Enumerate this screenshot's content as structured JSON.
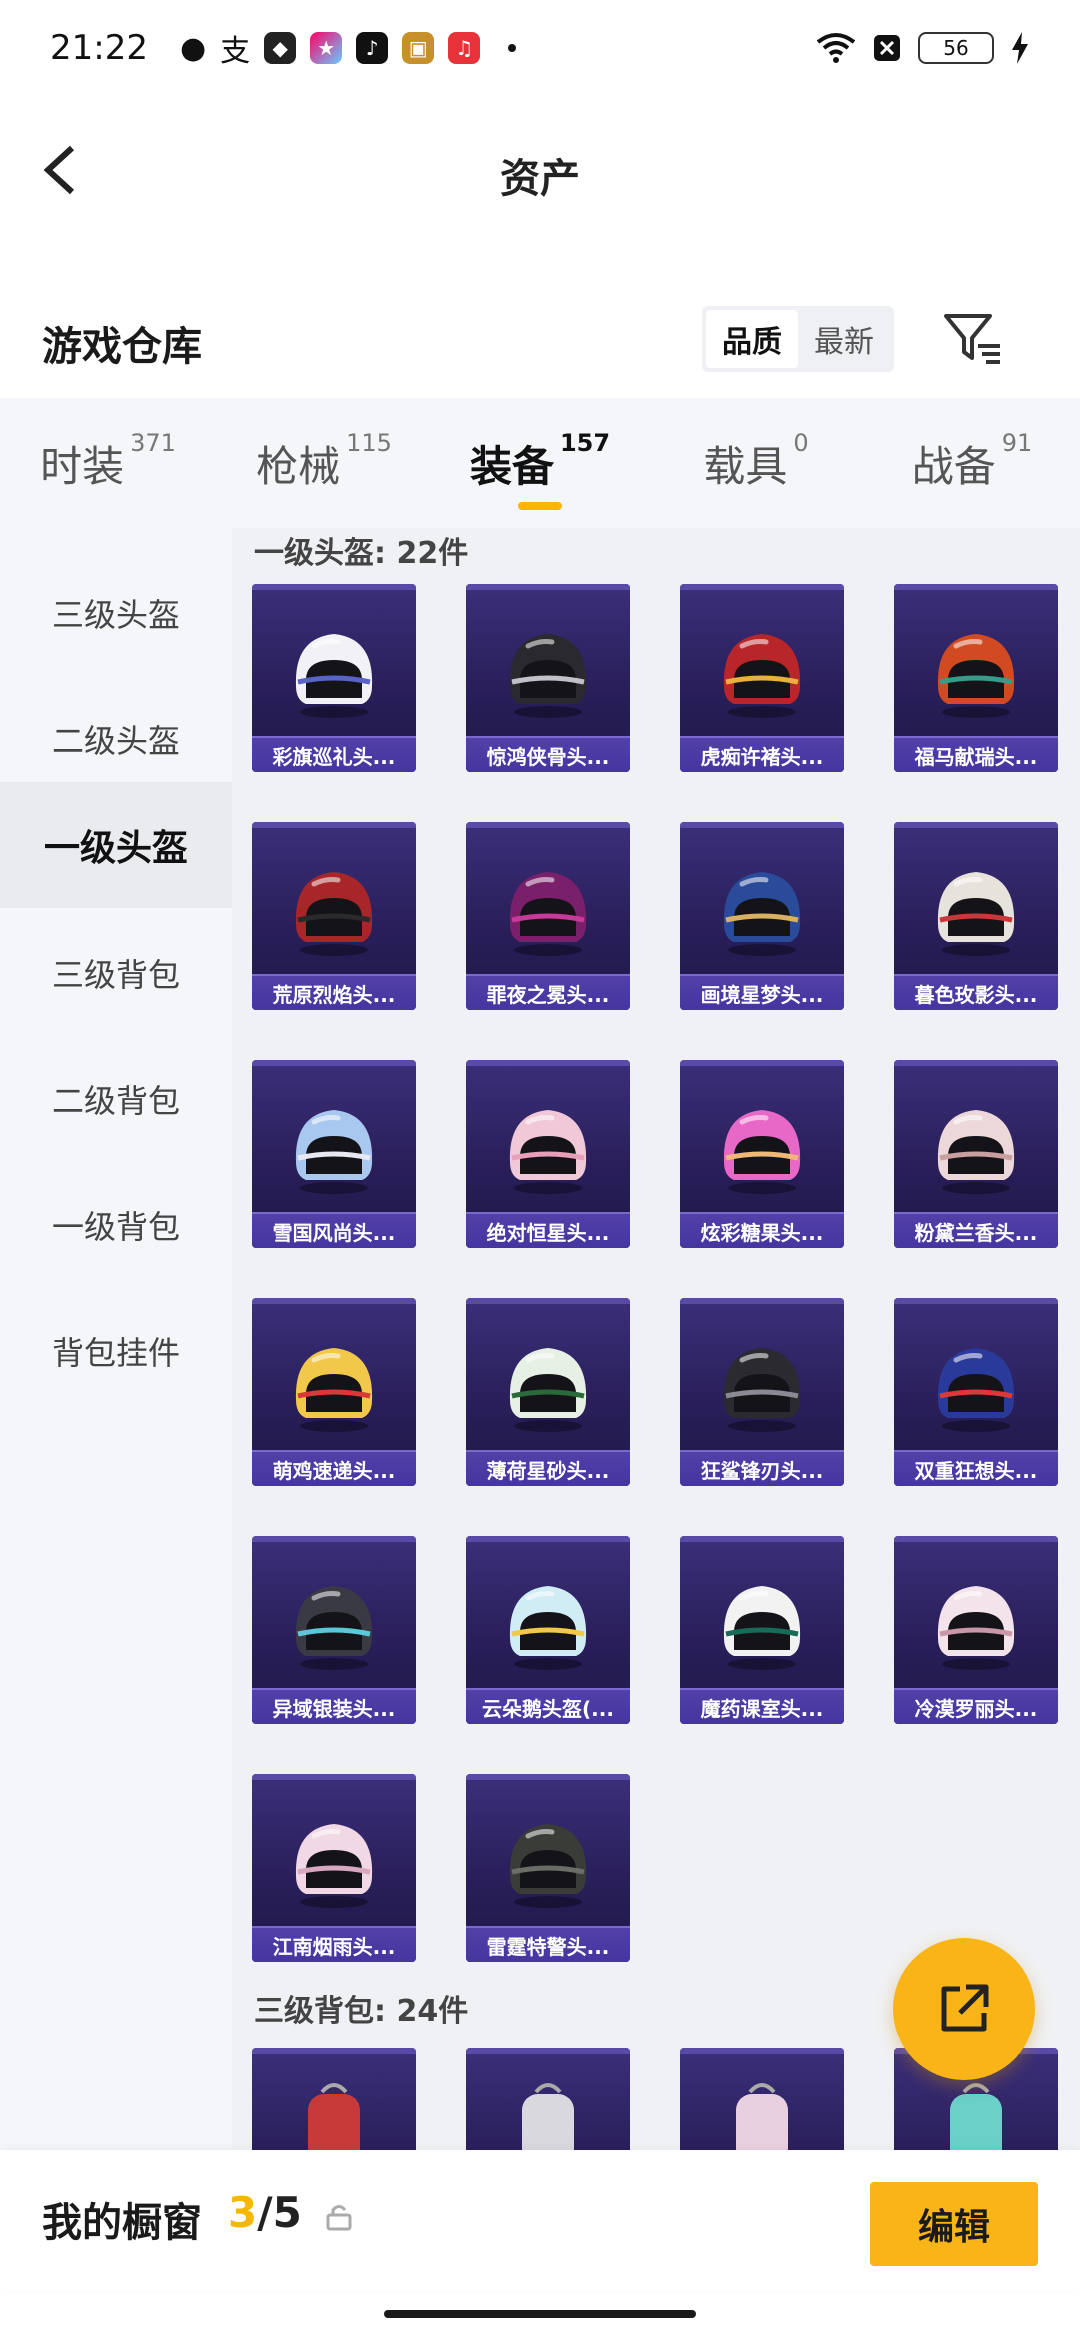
{
  "status_bar": {
    "time": "21:22",
    "battery": "56"
  },
  "header": {
    "title": "资产"
  },
  "section": {
    "title": "游戏仓库",
    "sort_options": [
      "品质",
      "最新"
    ]
  },
  "tabs": [
    {
      "label": "时装",
      "count": "371"
    },
    {
      "label": "枪械",
      "count": "115"
    },
    {
      "label": "装备",
      "count": "157"
    },
    {
      "label": "载具",
      "count": "0"
    },
    {
      "label": "战备",
      "count": "91"
    }
  ],
  "sidebar": {
    "items": [
      "三级头盔",
      "二级头盔",
      "一级头盔",
      "三级背包",
      "二级背包",
      "一级背包",
      "背包挂件"
    ]
  },
  "groups": [
    {
      "title": "一级头盔: 22件",
      "items": [
        {
          "name": "彩旗巡礼头...",
          "color": "#f2f2f6",
          "accent": "#5a64c8"
        },
        {
          "name": "惊鸿侠骨头...",
          "color": "#2a2a2e",
          "accent": "#c0c0c8"
        },
        {
          "name": "虎痴许褚头...",
          "color": "#b8262a",
          "accent": "#e8b040"
        },
        {
          "name": "福马献瑞头...",
          "color": "#d24a22",
          "accent": "#3a9a8a"
        },
        {
          "name": "荒原烈焰头...",
          "color": "#a8262a",
          "accent": "#2a2a2a"
        },
        {
          "name": "罪夜之冕头...",
          "color": "#7a1f6a",
          "accent": "#c83a9a"
        },
        {
          "name": "画境星梦头...",
          "color": "#2a4a9a",
          "accent": "#d8b060"
        },
        {
          "name": "暮色玫影头...",
          "color": "#e8e2dc",
          "accent": "#c83a3a"
        },
        {
          "name": "雪国风尚头...",
          "color": "#a8c8f0",
          "accent": "#e8e8f2"
        },
        {
          "name": "绝对恒星头...",
          "color": "#f0c8d8",
          "accent": "#e8a0b8"
        },
        {
          "name": "炫彩糖果头...",
          "color": "#e868c8",
          "accent": "#f0b878"
        },
        {
          "name": "粉黛兰香头...",
          "color": "#ecd8d8",
          "accent": "#c8a0a0"
        },
        {
          "name": "萌鸡速递头...",
          "color": "#f2c84a",
          "accent": "#d83a3a"
        },
        {
          "name": "薄荷星砂头...",
          "color": "#e6f0e4",
          "accent": "#2a6a3a"
        },
        {
          "name": "狂鲨锋刃头...",
          "color": "#2a2a30",
          "accent": "#8a8a92"
        },
        {
          "name": "双重狂想头...",
          "color": "#2a3a9a",
          "accent": "#d83a3a"
        },
        {
          "name": "异域银装头...",
          "color": "#3a3a44",
          "accent": "#5ac8d8"
        },
        {
          "name": "云朵鹅头盔(...",
          "color": "#d0ecf4",
          "accent": "#f2c84a"
        },
        {
          "name": "魔药课室头...",
          "color": "#f2f2f2",
          "accent": "#1a6a5a"
        },
        {
          "name": "冷漠罗丽头...",
          "color": "#f2e4ea",
          "accent": "#c898a8"
        },
        {
          "name": "江南烟雨头...",
          "color": "#f0d8e4",
          "accent": "#d8a8c0"
        },
        {
          "name": "雷霆特警头...",
          "color": "#3a3c38",
          "accent": "#6a6c66"
        }
      ]
    },
    {
      "title": "三级背包: 24件"
    }
  ],
  "bottom_bar": {
    "label": "我的橱窗",
    "count_current": "3",
    "count_total": "/5",
    "edit_label": "编辑"
  }
}
